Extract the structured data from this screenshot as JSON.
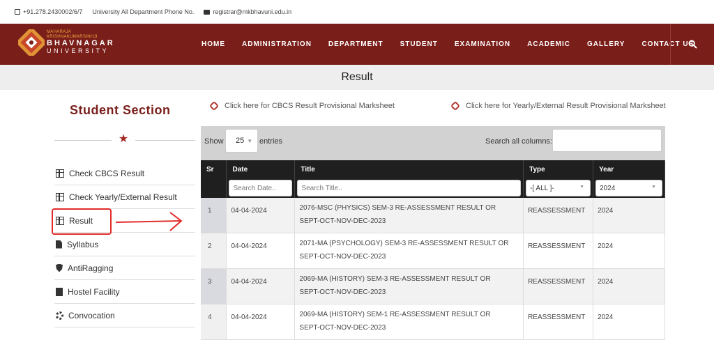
{
  "topbar": {
    "phone": "+91.278.2430002/6/7",
    "phone_label": "University All Department Phone No.",
    "email": "registrar@mkbhavuni.edu.in"
  },
  "header": {
    "logo_line1": "MAHARAJA",
    "logo_line2": "KRISHNAKUMARSINHJI",
    "logo_name": "BHAVNAGAR",
    "logo_uni": "UNIVERSITY",
    "nav": [
      "HOME",
      "ADMINISTRATION",
      "DEPARTMENT",
      "STUDENT",
      "EXAMINATION",
      "ACADEMIC",
      "GALLERY",
      "CONTACT US"
    ],
    "brand_color": "#7a1e1a"
  },
  "page_title": "Result",
  "sidebar": {
    "title": "Student Section",
    "items": [
      {
        "label": "Check CBCS Result",
        "icon": "table-icon"
      },
      {
        "label": "Check Yearly/External Result",
        "icon": "table-icon"
      },
      {
        "label": "Result",
        "icon": "list-icon"
      },
      {
        "label": "Syllabus",
        "icon": "file-icon"
      },
      {
        "label": "AntiRagging",
        "icon": "shield-icon"
      },
      {
        "label": "Hostel Facility",
        "icon": "building-icon"
      },
      {
        "label": "Convocation",
        "icon": "gear-icon"
      }
    ]
  },
  "links": {
    "cbcs": "Click here for CBCS Result Provisional Marksheet",
    "yearly": "Click here for Yearly/External Result Provisional Marksheet"
  },
  "table_controls": {
    "show": "Show",
    "length": "25",
    "entries": "entries",
    "search_label": "Search all columns:",
    "search_value": ""
  },
  "table": {
    "headers": [
      "Sr",
      "Date",
      "Title",
      "Type",
      "Year"
    ],
    "filters": {
      "date_placeholder": "Search Date..",
      "title_placeholder": "Search Title..",
      "type_value": "-[ ALL ]-",
      "year_value": "2024"
    },
    "rows": [
      {
        "sr": "1",
        "date": "04-04-2024",
        "title1": "2076-MSC (PHYSICS) SEM-3 RE-ASSESSMENT RESULT OR",
        "title2": "SEPT-OCT-NOV-DEC-2023",
        "type": "REASSESSMENT",
        "year": "2024"
      },
      {
        "sr": "2",
        "date": "04-04-2024",
        "title1": "2071-MA (PSYCHOLOGY) SEM-3 RE-ASSESSMENT RESULT OR",
        "title2": "SEPT-OCT-NOV-DEC-2023",
        "type": "REASSESSMENT",
        "year": "2024"
      },
      {
        "sr": "3",
        "date": "04-04-2024",
        "title1": "2069-MA (HISTORY) SEM-3 RE-ASSESSMENT RESULT OR",
        "title2": "SEPT-OCT-NOV-DEC-2023",
        "type": "REASSESSMENT",
        "year": "2024"
      },
      {
        "sr": "4",
        "date": "04-04-2024",
        "title1": "2069-MA (HISTORY) SEM-1 RE-ASSESSMENT RESULT OR",
        "title2": "SEPT-OCT-NOV-DEC-2023",
        "type": "REASSESSMENT",
        "year": "2024"
      }
    ]
  }
}
